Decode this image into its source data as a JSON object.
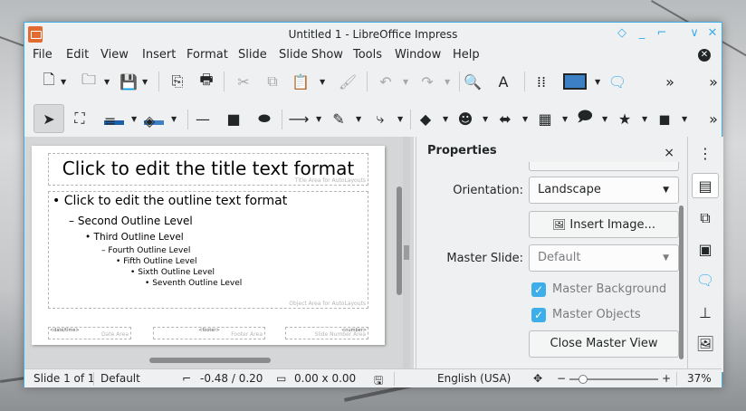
{
  "window": {
    "title": "Untitled 1 - LibreOffice Impress"
  },
  "menu": [
    "File",
    "Edit",
    "View",
    "Insert",
    "Format",
    "Slide",
    "Slide Show",
    "Tools",
    "Window",
    "Help"
  ],
  "slide": {
    "title_text": "Click to edit the title text format",
    "title_area_label": "Title Area for AutoLayouts",
    "outline": [
      "Click to edit the outline text format",
      "Second Outline Level",
      "Third Outline Level",
      "Fourth Outline Level",
      "Fifth Outline Level",
      "Sixth Outline Level",
      "Seventh Outline Level"
    ],
    "outline_bullets": [
      "•",
      "–",
      "•",
      "–",
      "•",
      "•",
      "•"
    ],
    "object_area_label": "Object Area for AutoLayouts",
    "footer": {
      "date_field": "<date/time>",
      "date_label": "Date Area",
      "footer_field": "<footer>",
      "footer_label": "Footer Area",
      "number_field": "<number>",
      "number_label": "Slide Number Area"
    }
  },
  "properties": {
    "title": "Properties",
    "orientation_label": "Orientation:",
    "orientation_value": "Landscape",
    "insert_image_label": "Insert Image...",
    "master_slide_label": "Master Slide:",
    "master_slide_value": "Default",
    "master_background_label": "Master Background",
    "master_objects_label": "Master Objects",
    "close_master_label": "Close Master View"
  },
  "status": {
    "slide_info": "Slide 1 of 1",
    "master": "Default",
    "position": "-0.48 / 0.20",
    "size": "0.00 x 0.00",
    "language": "English (USA)",
    "zoom": "37%"
  },
  "colors": {
    "accent": "#3daee9",
    "app_icon": "#e26b31",
    "line_color": "#1c5ea8",
    "fill_color": "#3d7fc4"
  }
}
